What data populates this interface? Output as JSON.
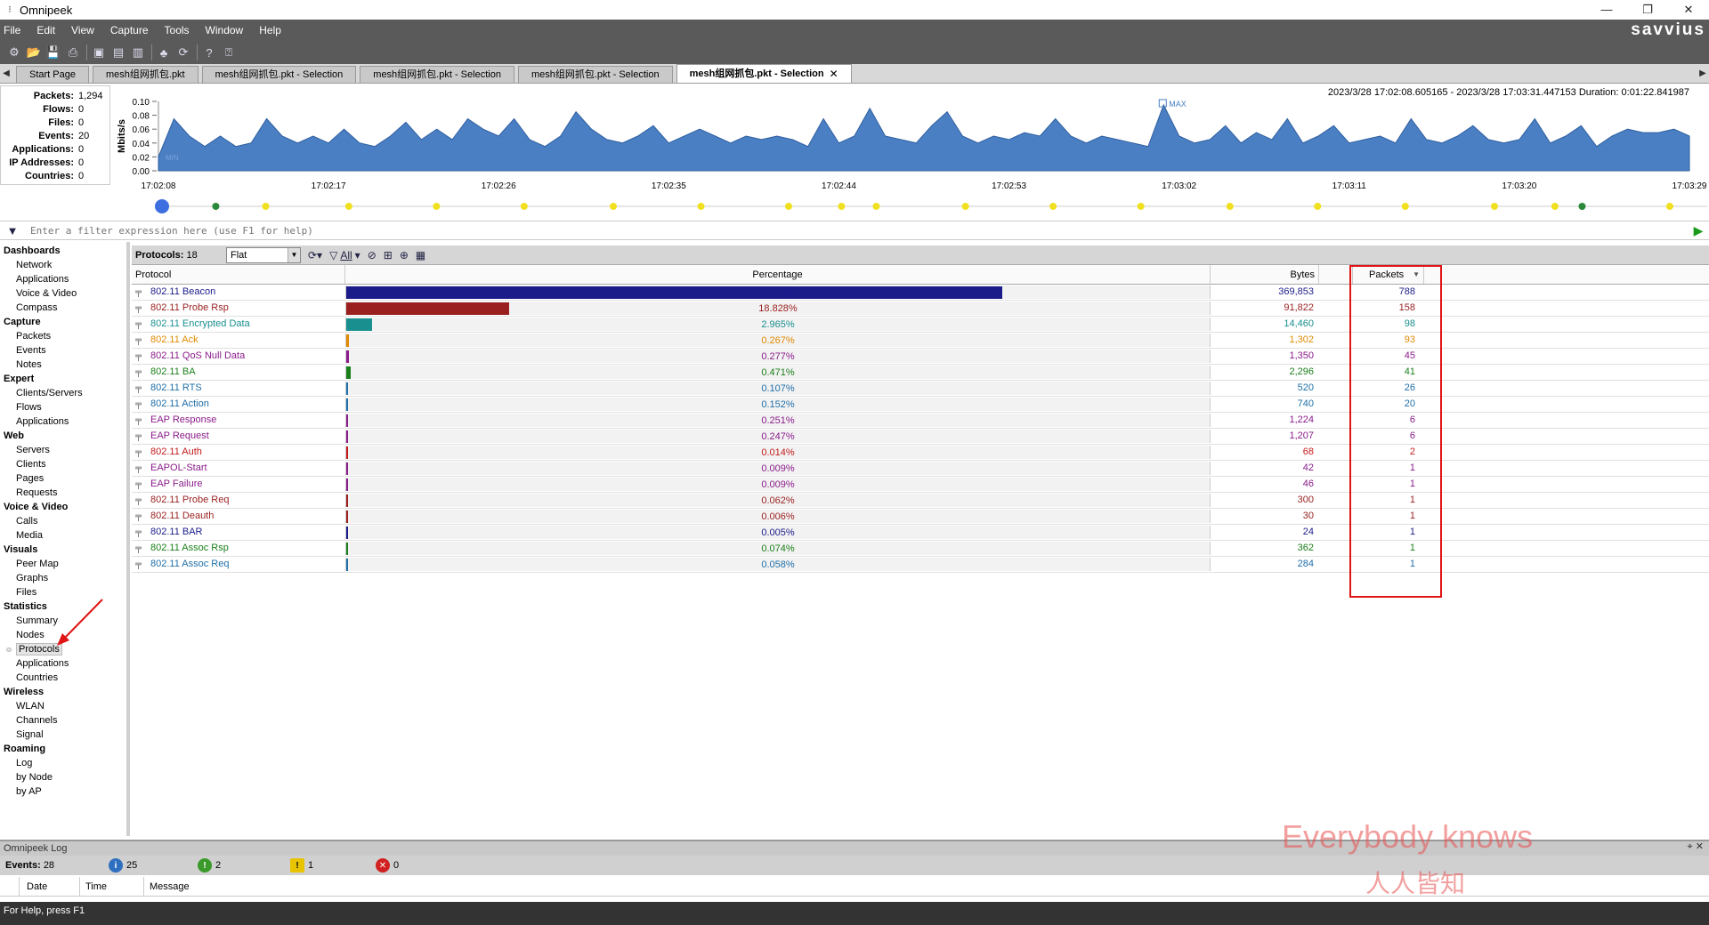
{
  "window": {
    "title": "Omnipeek",
    "brand": "savvius"
  },
  "menu": [
    "File",
    "Edit",
    "View",
    "Capture",
    "Tools",
    "Window",
    "Help"
  ],
  "tabs": [
    {
      "label": "Start Page",
      "active": false
    },
    {
      "label": "mesh组网抓包.pkt",
      "active": false
    },
    {
      "label": "mesh组网抓包.pkt - Selection",
      "active": false
    },
    {
      "label": "mesh组网抓包.pkt - Selection",
      "active": false
    },
    {
      "label": "mesh组网抓包.pkt - Selection",
      "active": false
    },
    {
      "label": "mesh组网抓包.pkt - Selection",
      "active": true
    }
  ],
  "stats": [
    {
      "k": "Packets:",
      "v": "1,294"
    },
    {
      "k": "Flows:",
      "v": "0"
    },
    {
      "k": "Files:",
      "v": "0"
    },
    {
      "k": "Events:",
      "v": "20"
    },
    {
      "k": "Applications:",
      "v": "0"
    },
    {
      "k": "IP Addresses:",
      "v": "0"
    },
    {
      "k": "Countries:",
      "v": "0"
    }
  ],
  "time_range": "2023/3/28 17:02:08.605165 - 2023/3/28 17:03:31.447153  Duration: 0:01:22.841987",
  "chart_data": {
    "type": "area",
    "ylabel": "Mbits/s",
    "ylim": [
      0,
      0.1
    ],
    "yticks": [
      "0.10",
      "0.08",
      "0.06",
      "0.04",
      "0.02",
      "0.00"
    ],
    "xticks": [
      "17:02:08",
      "17:02:17",
      "17:02:26",
      "17:02:35",
      "17:02:44",
      "17:02:53",
      "17:03:02",
      "17:03:11",
      "17:03:20",
      "17:03:29"
    ],
    "min_label": "MIN",
    "max_label": "MAX",
    "values": [
      0.02,
      0.075,
      0.05,
      0.035,
      0.05,
      0.035,
      0.04,
      0.075,
      0.05,
      0.04,
      0.05,
      0.04,
      0.06,
      0.04,
      0.035,
      0.05,
      0.07,
      0.045,
      0.06,
      0.045,
      0.075,
      0.06,
      0.05,
      0.075,
      0.045,
      0.035,
      0.05,
      0.085,
      0.06,
      0.045,
      0.04,
      0.05,
      0.065,
      0.04,
      0.05,
      0.06,
      0.05,
      0.04,
      0.05,
      0.045,
      0.05,
      0.045,
      0.035,
      0.075,
      0.04,
      0.05,
      0.09,
      0.05,
      0.045,
      0.04,
      0.065,
      0.085,
      0.05,
      0.04,
      0.05,
      0.045,
      0.055,
      0.05,
      0.075,
      0.05,
      0.04,
      0.05,
      0.045,
      0.04,
      0.035,
      0.095,
      0.05,
      0.04,
      0.045,
      0.065,
      0.04,
      0.055,
      0.045,
      0.075,
      0.04,
      0.05,
      0.065,
      0.04,
      0.045,
      0.05,
      0.04,
      0.075,
      0.045,
      0.04,
      0.05,
      0.065,
      0.045,
      0.04,
      0.045,
      0.075,
      0.04,
      0.05,
      0.065,
      0.035,
      0.05,
      0.06,
      0.055,
      0.055,
      0.06,
      0.05
    ]
  },
  "filter": {
    "placeholder": "Enter a filter expression here (use F1 for help)"
  },
  "sidebar": [
    {
      "group": "Dashboards",
      "items": [
        "Network",
        "Applications",
        "Voice & Video",
        "Compass"
      ]
    },
    {
      "group": "Capture",
      "items": [
        "Packets",
        "Events",
        "Notes"
      ]
    },
    {
      "group": "Expert",
      "items": [
        "Clients/Servers",
        "Flows",
        "Applications"
      ]
    },
    {
      "group": "Web",
      "items": [
        "Servers",
        "Clients",
        "Pages",
        "Requests"
      ]
    },
    {
      "group": "Voice & Video",
      "items": [
        "Calls",
        "Media"
      ]
    },
    {
      "group": "Visuals",
      "items": [
        "Peer Map",
        "Graphs",
        "Files"
      ]
    },
    {
      "group": "Statistics",
      "items": [
        "Summary",
        "Nodes",
        "Protocols",
        "Applications",
        "Countries"
      ]
    },
    {
      "group": "Wireless",
      "items": [
        "WLAN",
        "Channels",
        "Signal"
      ]
    },
    {
      "group": "Roaming",
      "items": [
        "Log",
        "by Node",
        "by AP"
      ]
    }
  ],
  "selected_sidebar": "Protocols",
  "protocols_toolbar": {
    "label": "Protocols:",
    "count": "18",
    "view": "Flat",
    "all": "All"
  },
  "columns": {
    "protocol": "Protocol",
    "percentage": "Percentage",
    "bytes": "Bytes",
    "packets": "Packets"
  },
  "rows": [
    {
      "name": "802.11 Beacon",
      "pct": "75.836%",
      "frac": 0.75836,
      "bytes": "369,853",
      "packets": "788",
      "color": "#1b1b8a"
    },
    {
      "name": "802.11 Probe Rsp",
      "pct": "18.828%",
      "frac": 0.18828,
      "bytes": "91,822",
      "packets": "158",
      "color": "#9a1f1f"
    },
    {
      "name": "802.11 Encrypted Data",
      "pct": "2.965%",
      "frac": 0.02965,
      "bytes": "14,460",
      "packets": "98",
      "color": "#1a8f8f"
    },
    {
      "name": "802.11 Ack",
      "pct": "0.267%",
      "frac": 0.00267,
      "bytes": "1,302",
      "packets": "93",
      "color": "#e08a00"
    },
    {
      "name": "802.11 QoS Null Data",
      "pct": "0.277%",
      "frac": 0.00277,
      "bytes": "1,350",
      "packets": "45",
      "color": "#8a1b8a"
    },
    {
      "name": "802.11 BA",
      "pct": "0.471%",
      "frac": 0.00471,
      "bytes": "2,296",
      "packets": "41",
      "color": "#1a7f1a"
    },
    {
      "name": "802.11 RTS",
      "pct": "0.107%",
      "frac": 0.00107,
      "bytes": "520",
      "packets": "26",
      "color": "#1f6fa8"
    },
    {
      "name": "802.11 Action",
      "pct": "0.152%",
      "frac": 0.00152,
      "bytes": "740",
      "packets": "20",
      "color": "#1f6fa8"
    },
    {
      "name": "EAP Response",
      "pct": "0.251%",
      "frac": 0.00251,
      "bytes": "1,224",
      "packets": "6",
      "color": "#8a1b8a"
    },
    {
      "name": "EAP Request",
      "pct": "0.247%",
      "frac": 0.00247,
      "bytes": "1,207",
      "packets": "6",
      "color": "#8a1b8a"
    },
    {
      "name": "802.11 Auth",
      "pct": "0.014%",
      "frac": 0.00014,
      "bytes": "68",
      "packets": "2",
      "color": "#c41a1a"
    },
    {
      "name": "EAPOL-Start",
      "pct": "0.009%",
      "frac": 9e-05,
      "bytes": "42",
      "packets": "1",
      "color": "#8a1b8a"
    },
    {
      "name": "EAP Failure",
      "pct": "0.009%",
      "frac": 9e-05,
      "bytes": "46",
      "packets": "1",
      "color": "#8a1b8a"
    },
    {
      "name": "802.11 Probe Req",
      "pct": "0.062%",
      "frac": 0.00062,
      "bytes": "300",
      "packets": "1",
      "color": "#9a1f1f"
    },
    {
      "name": "802.11 Deauth",
      "pct": "0.006%",
      "frac": 6e-05,
      "bytes": "30",
      "packets": "1",
      "color": "#9a1f1f"
    },
    {
      "name": "802.11 BAR",
      "pct": "0.005%",
      "frac": 5e-05,
      "bytes": "24",
      "packets": "1",
      "color": "#1b1b8a"
    },
    {
      "name": "802.11 Assoc Rsp",
      "pct": "0.074%",
      "frac": 0.00074,
      "bytes": "362",
      "packets": "1",
      "color": "#1a7f1a"
    },
    {
      "name": "802.11 Assoc Req",
      "pct": "0.058%",
      "frac": 0.00058,
      "bytes": "284",
      "packets": "1",
      "color": "#1f6fa8"
    }
  ],
  "log": {
    "title": "Omnipeek Log",
    "events_label": "Events:",
    "events_count": "28",
    "info": "25",
    "ok": "2",
    "warn": "1",
    "err": "0",
    "cols": [
      "Date",
      "Time",
      "Message"
    ]
  },
  "watermark": {
    "line1": "Everybody knows",
    "line2": "人人皆知"
  },
  "statusbar": "For Help, press F1",
  "colors": {
    "accent_graph": "#4a7fc4",
    "highlight": "#e01414",
    "menubar": "#5a5a5a"
  }
}
